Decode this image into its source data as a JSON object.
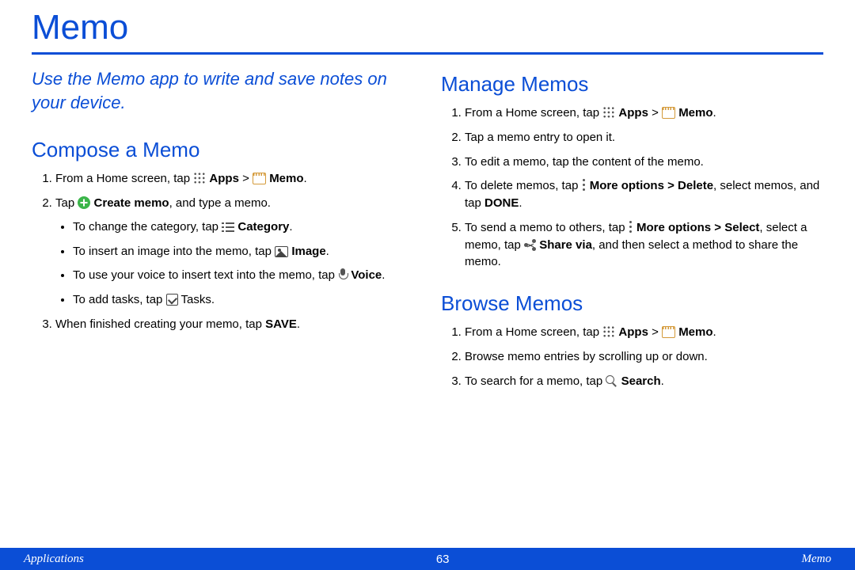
{
  "title": "Memo",
  "intro": "Use the Memo app to write and save notes on your device.",
  "sections": {
    "compose": {
      "heading": "Compose a Memo",
      "s1a": "From a Home screen, tap ",
      "apps": "Apps",
      "sep": " > ",
      "memo": "Memo",
      "dot": ".",
      "s2a": "Tap ",
      "create": "Create memo",
      "s2b": ", and type a memo.",
      "b1a": "To change the category, tap ",
      "cat": "Category",
      "b2a": "To insert an image into the memo, tap ",
      "img": "Image",
      "b3a": "To use your voice to insert text into the memo, tap ",
      "voice": "Voice",
      "b4a": "To add tasks, tap ",
      "tasks": " Tasks.",
      "s3a": "When finished creating your memo, tap ",
      "save": "SAVE"
    },
    "manage": {
      "heading": "Manage Memos",
      "s1a": "From a Home screen, tap ",
      "s2": "Tap a memo entry to open it.",
      "s3": "To edit a memo, tap the content of the memo.",
      "s4a": "To delete memos, tap ",
      "more": "More options",
      "del": " > Delete",
      "s4b": ", select memos, and tap ",
      "done": "DONE",
      "s5a": "To send a memo to others, tap ",
      "s5b": " > Select",
      "s5c": ", select a memo, tap ",
      "share": "Share via",
      "s5d": ", and then select a method to share the memo."
    },
    "browse": {
      "heading": "Browse Memos",
      "s1a": "From a Home screen, tap ",
      "s2": "Browse memo entries by scrolling up or down.",
      "s3a": "To search for a memo, tap ",
      "search": "Search"
    }
  },
  "footer": {
    "left": "Applications",
    "center": "63",
    "right": "Memo"
  }
}
